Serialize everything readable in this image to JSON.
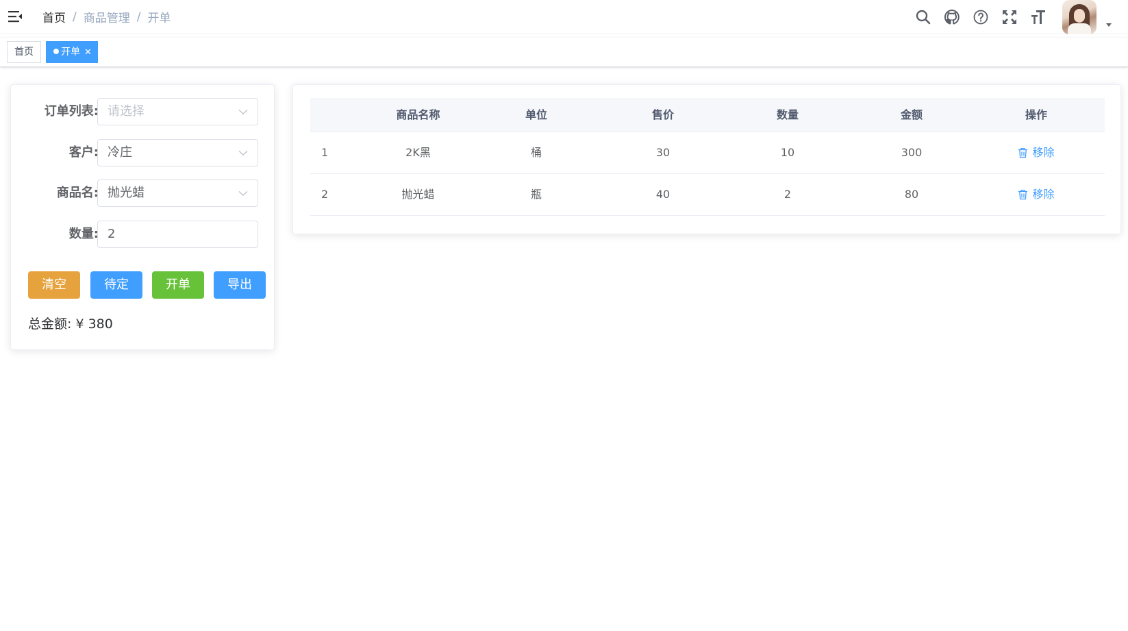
{
  "navbar": {
    "breadcrumb": [
      "首页",
      "商品管理",
      "开单"
    ],
    "separator": "/",
    "icons": [
      "hamburger-icon",
      "search-icon",
      "github-icon",
      "help-icon",
      "fullscreen-icon",
      "font-size-icon"
    ]
  },
  "tags": {
    "home": "首页",
    "current": "开单"
  },
  "form": {
    "order_list_label": "订单列表:",
    "order_list_placeholder": "请选择",
    "customer_label": "客户:",
    "customer_value": "冷庄",
    "product_label": "商品名:",
    "product_value": "抛光蜡",
    "quantity_label": "数量:",
    "quantity_value": "2"
  },
  "buttons": {
    "clear": "清空",
    "hold": "待定",
    "open": "开单",
    "export": "导出"
  },
  "total": "总金额: ¥ 380",
  "table": {
    "headers": [
      "",
      "商品名称",
      "单位",
      "售价",
      "数量",
      "金额",
      "操作"
    ],
    "rows": [
      {
        "index": "1",
        "name": "2K黑",
        "unit": "桶",
        "price": "30",
        "qty": "10",
        "amount": "300",
        "action": "移除"
      },
      {
        "index": "2",
        "name": "抛光蜡",
        "unit": "瓶",
        "price": "40",
        "qty": "2",
        "amount": "80",
        "action": "移除"
      }
    ]
  },
  "colors": {
    "primary": "#409eff",
    "warning": "#e6a23c",
    "success": "#67c23a"
  }
}
